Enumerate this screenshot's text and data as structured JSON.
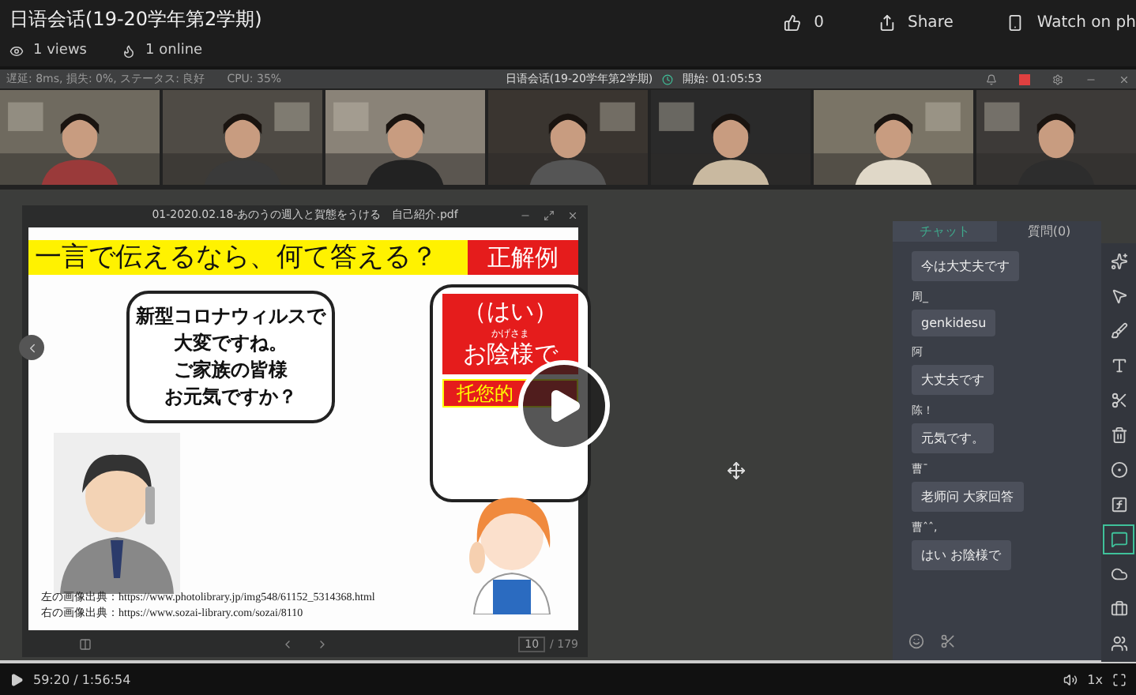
{
  "video": {
    "title": "日语会话(19-20学年第2学期)",
    "views": "1 views",
    "online": "1 online",
    "likes": "0",
    "share": "Share",
    "watch": "Watch on ph"
  },
  "classroom": {
    "status": "遅延: 8ms, 損失: 0%, ステータス: 良好",
    "cpu": "CPU: 35%",
    "title": "日语会话(19-20学年第2学期)",
    "start": "開始: 01:05:53"
  },
  "document": {
    "filename": "01-2020.02.18-あのうの週入と賀態をうける　自己紹介.pdf",
    "banner": "一言で伝えるなら、何て答える？",
    "banner_tag": "正解例",
    "left_bubble": [
      "新型コロナウィルスで",
      "大変ですね。",
      "ご家族の皆様",
      "お元気ですか？"
    ],
    "right_bubble": {
      "line1": "（はい）",
      "ruby": "かげさま",
      "line2": "お陰様で",
      "translation": "托您的"
    },
    "credits": [
      "左の画像出典：https://www.photolibrary.jp/img548/61152_5314368.html",
      "右の画像出典：https://www.sozai-library.com/sozai/8110"
    ],
    "page": "10",
    "page_total": "/ 179"
  },
  "chat": {
    "tabs": [
      {
        "label": "チャット",
        "selected": true
      },
      {
        "label": "質問(0)",
        "selected": false
      }
    ],
    "messages": [
      {
        "text": "今は大丈夫です"
      },
      {
        "sender": "周_",
        "text": "genkidesu"
      },
      {
        "sender": "阿",
        "text": "大丈夫です"
      },
      {
        "sender": "陈！",
        "text": "元気です。"
      },
      {
        "sender": "曹¯",
        "text": "老师问 大家回答"
      },
      {
        "sender": "曹ˆˆ,",
        "text": "はい お陰様で"
      }
    ]
  },
  "toolbar": [
    {
      "kind": "laser",
      "selected": false
    },
    {
      "kind": "move",
      "selected": false
    },
    {
      "kind": "brush",
      "selected": false
    },
    {
      "kind": "text",
      "selected": false
    },
    {
      "kind": "cut",
      "selected": false
    },
    {
      "kind": "trash",
      "selected": false
    },
    {
      "kind": "shape",
      "selected": false
    },
    {
      "kind": "formula",
      "selected": false
    },
    {
      "kind": "chat",
      "selected": true
    },
    {
      "kind": "cloud",
      "selected": false
    },
    {
      "kind": "toolbox",
      "selected": false
    },
    {
      "kind": "users",
      "selected": false
    }
  ],
  "player": {
    "time": "59:20 / 1:56:54",
    "speed": "1x"
  }
}
